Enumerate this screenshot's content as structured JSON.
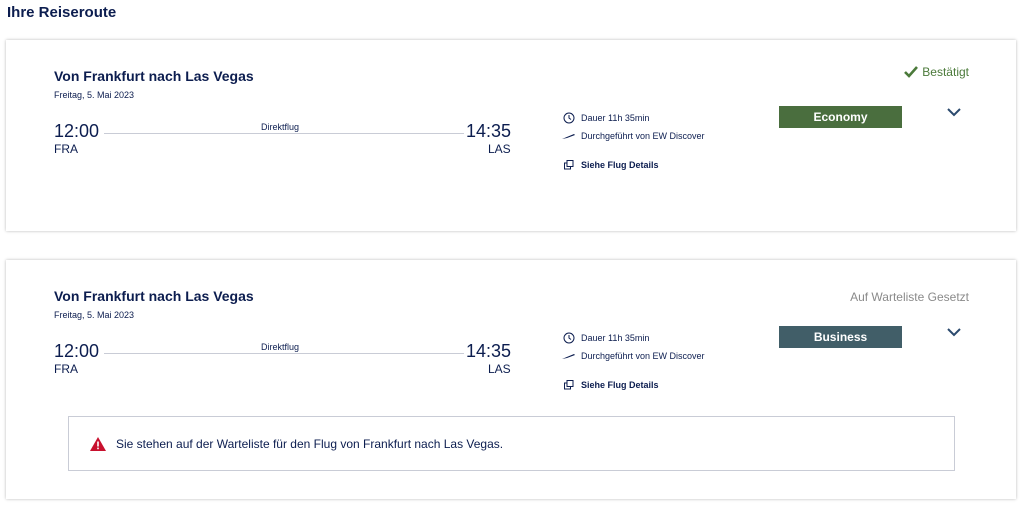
{
  "page": {
    "title": "Ihre Reiseroute"
  },
  "flights": [
    {
      "route": "Von Frankfurt nach Las Vegas",
      "date": "Freitag, 5. Mai 2023",
      "departure_time": "12:00",
      "departure_code": "FRA",
      "arrival_time": "14:35",
      "arrival_code": "LAS",
      "stops": "Direktflug",
      "duration": "Dauer 11h 35min",
      "operator": "Durchgeführt von EW Discover",
      "details_link": "Siehe Flug Details",
      "cabin_class": "Economy",
      "status": "Bestätigt",
      "status_color": "#4b7a3a",
      "class_color": "#4a6e3e"
    },
    {
      "route": "Von Frankfurt nach Las Vegas",
      "date": "Freitag, 5. Mai 2023",
      "departure_time": "12:00",
      "departure_code": "FRA",
      "arrival_time": "14:35",
      "arrival_code": "LAS",
      "stops": "Direktflug",
      "duration": "Dauer 11h 35min",
      "operator": "Durchgeführt von EW Discover",
      "details_link": "Siehe Flug Details",
      "cabin_class": "Business",
      "status": "Auf Warteliste Gesetzt",
      "status_color": "#8a8a8a",
      "class_color": "#415e68",
      "alert": "Sie stehen auf der Warteliste für den Flug von Frankfurt nach Las Vegas."
    }
  ],
  "icons": {
    "confirmed": "checkmark-icon",
    "duration": "clock-icon",
    "operator": "airplane-icon",
    "details": "external-link-icon",
    "expand": "chevron-down-icon",
    "alert": "warning-icon"
  }
}
